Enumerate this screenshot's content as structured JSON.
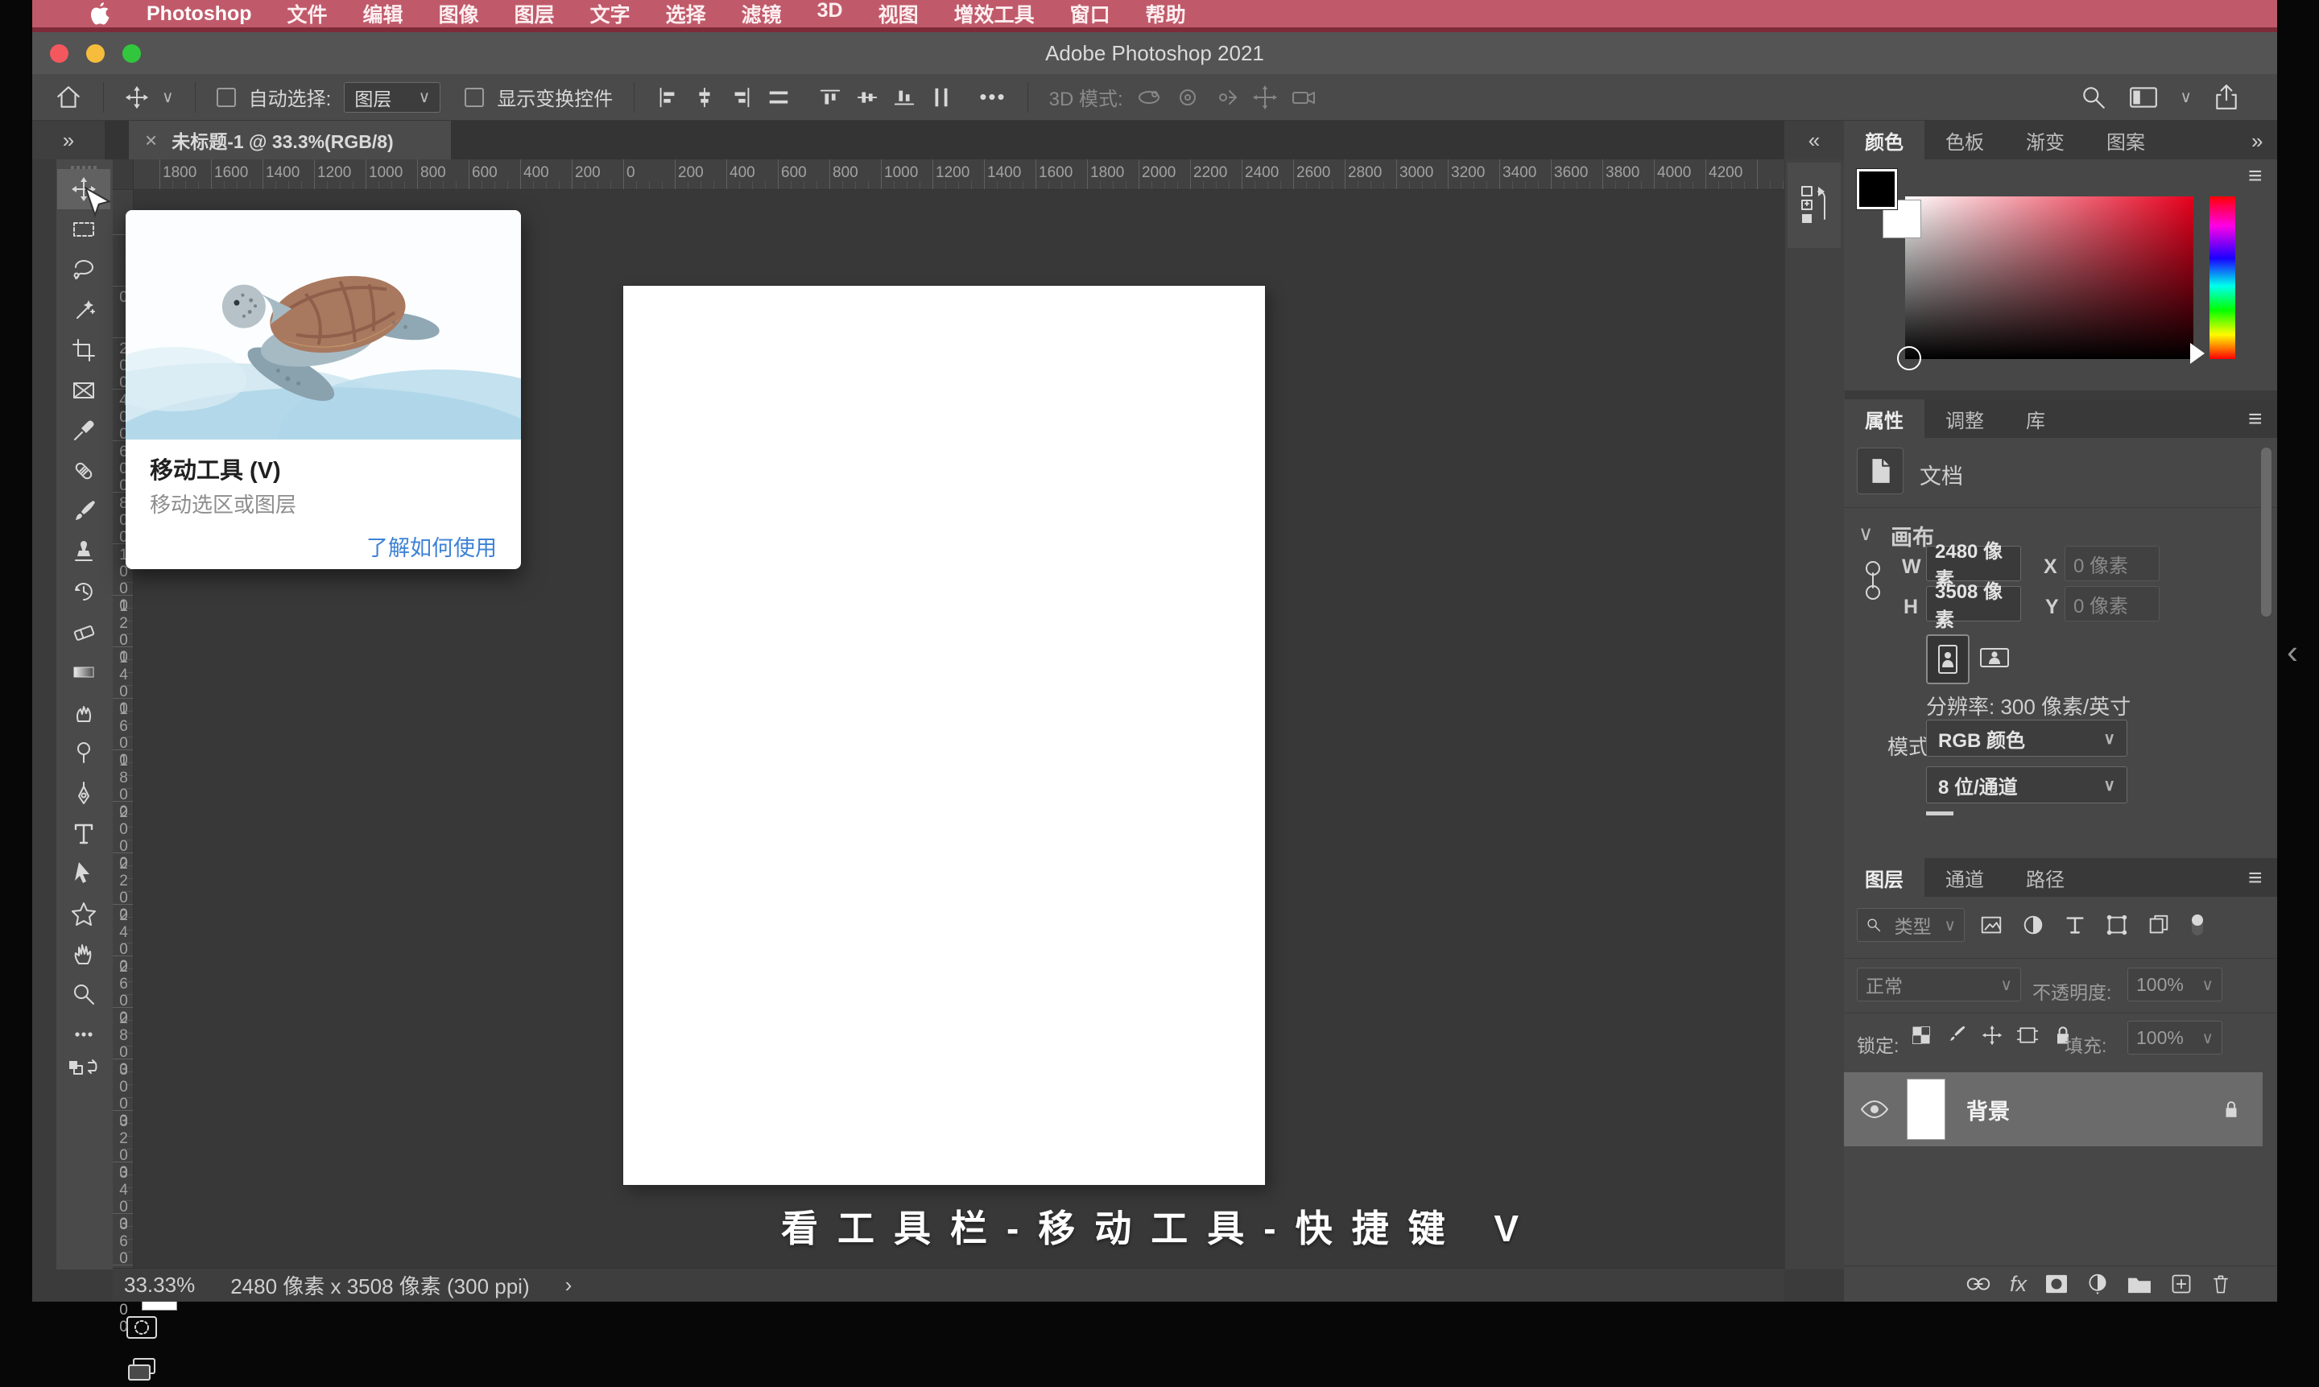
{
  "menu_bar": {
    "app_name": "Photoshop",
    "items": [
      "文件",
      "编辑",
      "图像",
      "图层",
      "文字",
      "选择",
      "滤镜",
      "3D",
      "视图",
      "增效工具",
      "窗口",
      "帮助"
    ]
  },
  "title_bar": {
    "title": "Adobe Photoshop 2021"
  },
  "options_bar": {
    "auto_select_label": "自动选择:",
    "auto_select_value": "图层",
    "show_transform_label": "显示变换控件",
    "mode_3d_label": "3D 模式:"
  },
  "tab_bar": {
    "doc_title": "未标题-1 @ 33.3%(RGB/8)"
  },
  "rulers": {
    "horizontal": [
      "1800",
      "1600",
      "1400",
      "1200",
      "1000",
      "800",
      "600",
      "400",
      "200",
      "0",
      "200",
      "400",
      "600",
      "800",
      "1000",
      "1200",
      "1400",
      "1600",
      "1800",
      "2000",
      "2200",
      "2400",
      "2600",
      "2800",
      "3000",
      "3200",
      "3400",
      "3600",
      "3800",
      "4000",
      "4200"
    ],
    "vertical": [
      "0",
      "200",
      "400",
      "600",
      "800",
      "1000",
      "1200",
      "1400",
      "1600",
      "1800",
      "2000",
      "2200",
      "2400",
      "2600",
      "2800",
      "3000",
      "3200",
      "3400",
      "3600",
      "3800"
    ]
  },
  "tooltip": {
    "title": "移动工具 (V)",
    "description": "移动选区或图层",
    "link": "了解如何使用"
  },
  "caption": {
    "text": "看工具栏-移动工具-快捷键 V"
  },
  "status_bar": {
    "zoom": "33.33%",
    "doc_info": "2480 像素 x 3508 像素 (300 ppi)"
  },
  "color_panel": {
    "tabs": [
      "颜色",
      "色板",
      "渐变",
      "图案"
    ]
  },
  "properties_panel": {
    "tabs": [
      "属性",
      "调整",
      "库"
    ],
    "doc_type_label": "文档",
    "section_canvas": "画布",
    "w_label": "W",
    "w_value": "2480 像素",
    "x_label": "X",
    "x_value": "0 像素",
    "h_label": "H",
    "h_value": "3508 像素",
    "y_label": "Y",
    "y_value": "0 像素",
    "resolution": "分辨率: 300 像素/英寸",
    "mode_label": "模式",
    "mode_value": "RGB 颜色",
    "depth_value": "8 位/通道"
  },
  "layers_panel": {
    "tabs": [
      "图层",
      "通道",
      "路径"
    ],
    "filter_placeholder": "类型",
    "blend_mode": "正常",
    "opacity_label": "不透明度:",
    "opacity_value": "100%",
    "lock_label": "锁定:",
    "fill_label": "填充:",
    "fill_value": "100%",
    "layer": {
      "name": "背景"
    }
  },
  "icons": {
    "chevron_down": "∨",
    "close": "×",
    "collapse_left": "«",
    "collapse_right": "»",
    "hamburger": "≡",
    "ellipsis": "•••",
    "panel_expand": "‹",
    "status_chevron": "›"
  },
  "colors": {
    "menu_bar": "#c05a6a",
    "link_blue": "#3e82d6",
    "selected_hue": "#ff0000",
    "foreground_swatch": "#000000",
    "background_swatch": "#ffffff"
  }
}
